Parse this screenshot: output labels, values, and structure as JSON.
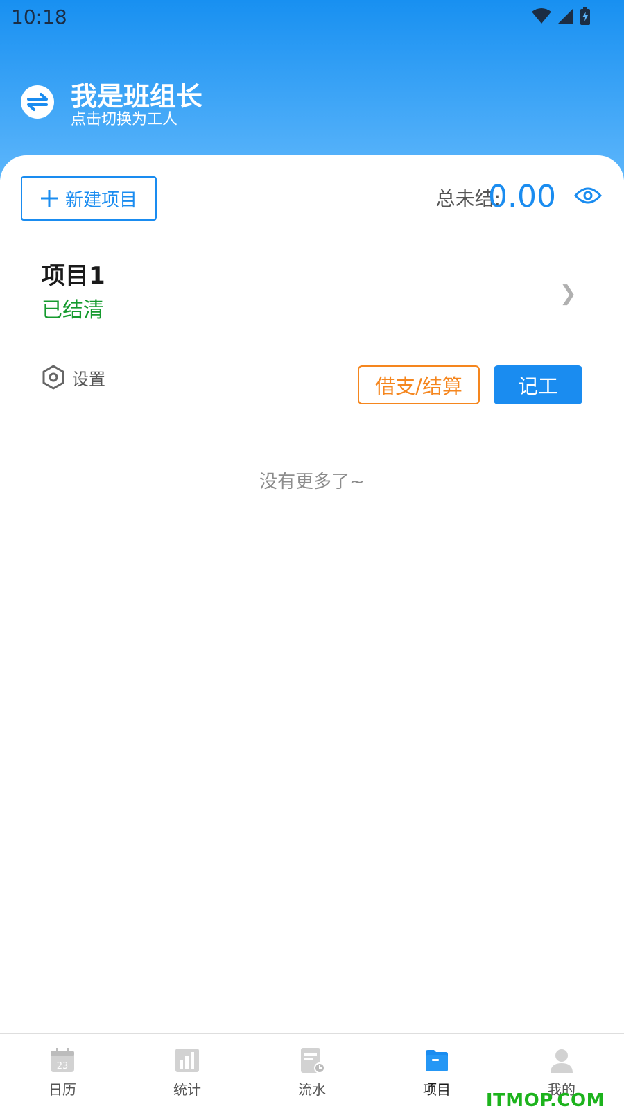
{
  "status_bar": {
    "time": "10:18"
  },
  "header": {
    "role_title": "我是班组长",
    "role_subtitle": "点击切换为工人"
  },
  "toolbar": {
    "new_project_label": "新建项目",
    "total_unsettled_label": "总未结:",
    "total_unsettled_value": "0.00"
  },
  "project": {
    "name": "项目1",
    "status": "已结清"
  },
  "actions": {
    "settings_label": "设置",
    "loan_settle_label": "借支/结算",
    "record_label": "记工"
  },
  "list_footer": "没有更多了~",
  "tabbar": [
    {
      "label": "日历",
      "icon": "calendar-icon",
      "active": false
    },
    {
      "label": "统计",
      "icon": "bar-chart-icon",
      "active": false
    },
    {
      "label": "流水",
      "icon": "ledger-icon",
      "active": false
    },
    {
      "label": "项目",
      "icon": "folder-icon",
      "active": true
    },
    {
      "label": "我的",
      "icon": "user-icon",
      "active": false
    }
  ],
  "watermark": "ITMOP.COM",
  "colors": {
    "primary": "#1a8cf0",
    "accent_orange": "#f5861e",
    "success_green": "#159a2e"
  }
}
